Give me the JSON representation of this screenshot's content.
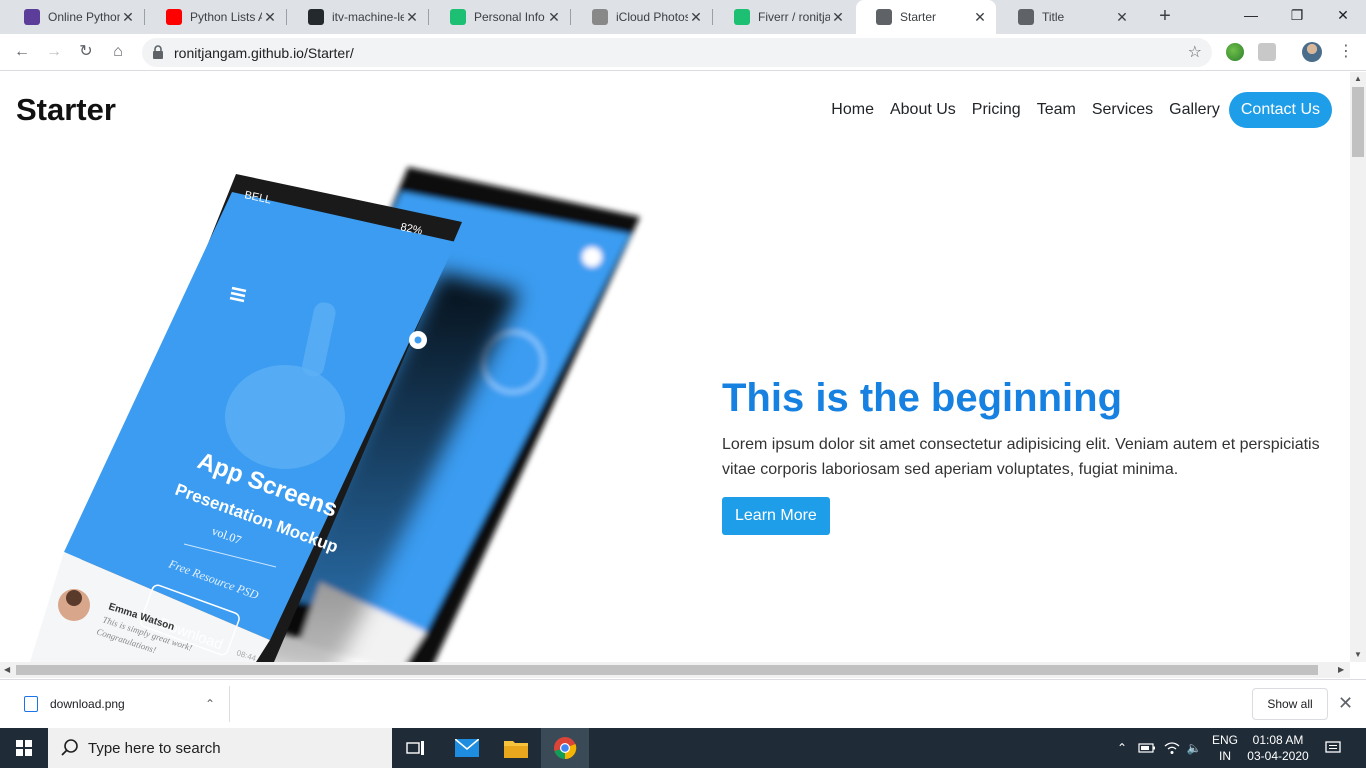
{
  "browser": {
    "tabs": [
      {
        "title": "Online Python",
        "favicon": "replit-icon",
        "color": "#5c3d99"
      },
      {
        "title": "Python Lists A",
        "favicon": "youtube-icon",
        "color": "#ff0000"
      },
      {
        "title": "itv-machine-le",
        "favicon": "github-icon",
        "color": "#24292e"
      },
      {
        "title": "Personal Info",
        "favicon": "fiverr-icon",
        "color": "#1dbf73"
      },
      {
        "title": "iCloud Photos",
        "favicon": "apple-icon",
        "color": "#888888"
      },
      {
        "title": "Fiverr / ronitja",
        "favicon": "fiverr-icon",
        "color": "#1dbf73"
      },
      {
        "title": "Starter",
        "favicon": "globe-icon",
        "color": "#5f6368"
      },
      {
        "title": "Title",
        "favicon": "globe-icon",
        "color": "#5f6368"
      }
    ],
    "active_tab": 6,
    "url": "ronitjangam.github.io/Starter/"
  },
  "site": {
    "brand": "Starter",
    "nav": [
      "Home",
      "About Us",
      "Pricing",
      "Team",
      "Services",
      "Gallery"
    ],
    "cta": "Contact Us",
    "hero": {
      "title": "This is the beginning",
      "text": "Lorem ipsum dolor sit amet consectetur adipisicing elit. Veniam autem et perspiciatis vitae corporis laboriosam sed aperiam voluptates, fugiat minima.",
      "button": "Learn More"
    },
    "mockup": {
      "carrier": "BELL",
      "battery": "82%",
      "title": "App Screens",
      "subtitle": "Presentation Mockup",
      "version": "vol.07",
      "resource": "Free Resource PSD",
      "download": "Download",
      "user": "Emma Watson",
      "comment1": "This is simply great work!",
      "comment2": "Congratulations!",
      "time": "08:44",
      "accent": "#3b9cf1"
    }
  },
  "downloads": {
    "file": "download.png",
    "show_all": "Show all"
  },
  "taskbar": {
    "search_placeholder": "Type here to search",
    "lang_line1": "ENG",
    "lang_line2": "IN",
    "time": "01:08 AM",
    "date": "03-04-2020"
  }
}
